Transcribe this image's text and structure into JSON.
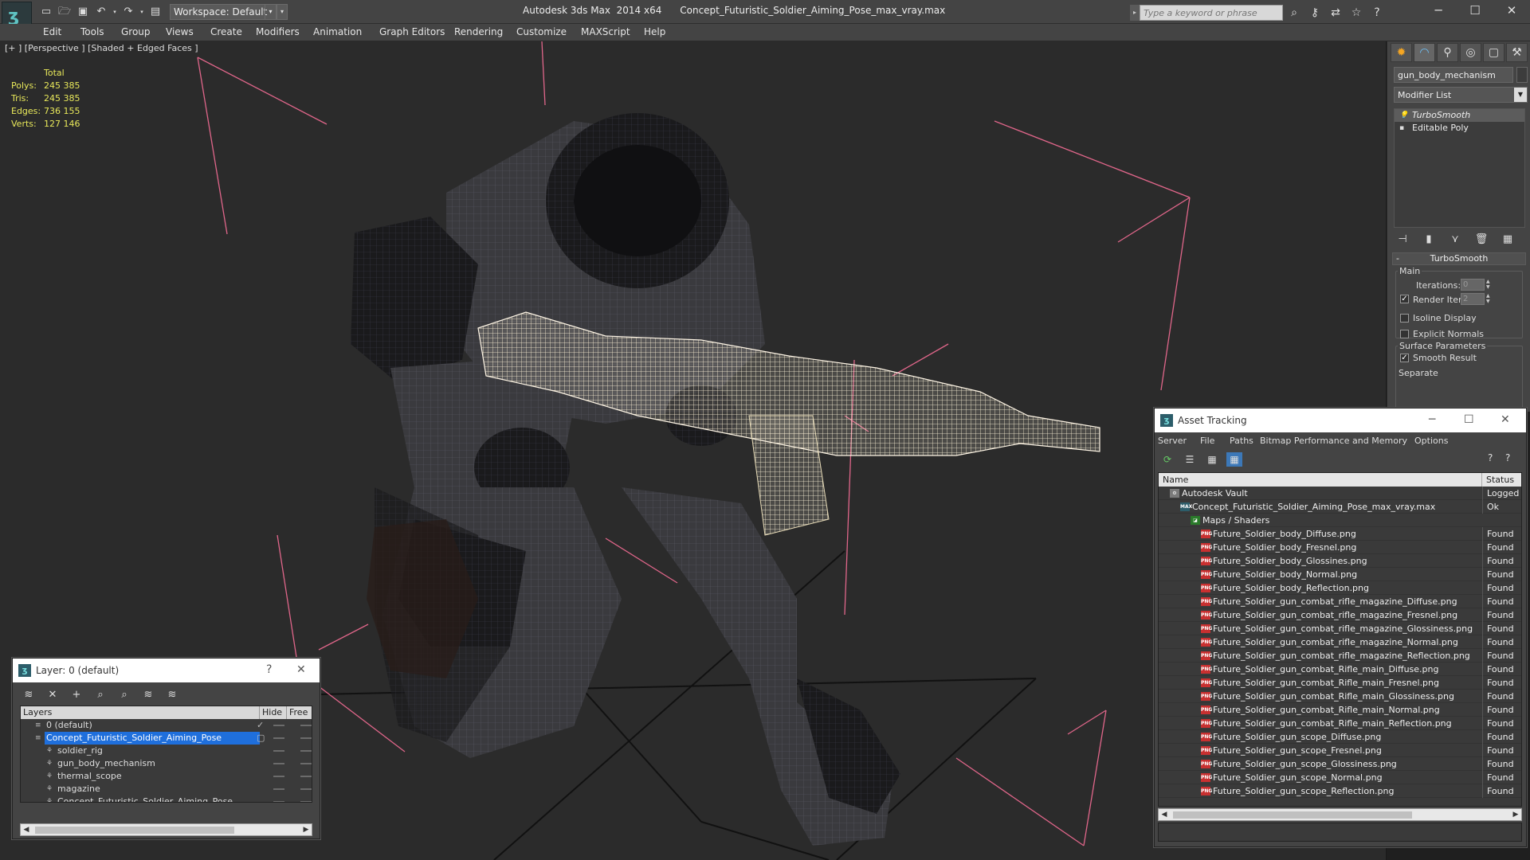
{
  "titlebar": {
    "workspace_label": "Workspace: Default",
    "app_name": "Autodesk 3ds Max  2014 x64",
    "file_name": "Concept_Futuristic_Soldier_Aiming_Pose_max_vray.max",
    "search_placeholder": "Type a keyword or phrase"
  },
  "menubar": [
    "Edit",
    "Tools",
    "Group",
    "Views",
    "Create",
    "Modifiers",
    "Animation",
    "Graph Editors",
    "Rendering",
    "Customize",
    "MAXScript",
    "Help"
  ],
  "viewport": {
    "label": "[+ ] [Perspective ] [Shaded + Edged Faces ]",
    "stats": {
      "header": "Total",
      "rows": [
        {
          "k": "Polys:",
          "v": "245 385"
        },
        {
          "k": "Tris:",
          "v": "245 385"
        },
        {
          "k": "Edges:",
          "v": "736 155"
        },
        {
          "k": "Verts:",
          "v": "127 146"
        }
      ]
    }
  },
  "command_panel": {
    "object_name": "gun_body_mechanism",
    "modifier_list": "Modifier List",
    "stack": [
      "TurboSmooth",
      "Editable Poly"
    ],
    "rollout": "TurboSmooth",
    "group_main": "Main",
    "iterations_label": "Iterations:",
    "iterations_value": "0",
    "render_iters_label": "Render Iters:",
    "render_iters_value": "2",
    "isoline": "Isoline Display",
    "explicit_normals": "Explicit Normals",
    "group_surface": "Surface Parameters",
    "smooth_result": "Smooth Result",
    "separate": "Separate",
    "render_iters_checked": true,
    "smooth_result_checked": true
  },
  "layer_window": {
    "title": "Layer: 0 (default)",
    "help": "?",
    "columns": [
      "Layers",
      "Hide",
      "Free"
    ],
    "rows": [
      {
        "name": "0 (default)",
        "level": 0
      },
      {
        "name": "Concept_Futuristic_Soldier_Aiming_Pose",
        "level": 0,
        "selected": true
      },
      {
        "name": "soldier_rig",
        "level": 1
      },
      {
        "name": "gun_body_mechanism",
        "level": 1
      },
      {
        "name": "thermal_scope",
        "level": 1
      },
      {
        "name": "magazine",
        "level": 1
      },
      {
        "name": "Concept_Futuristic_Soldier_Aiming_Pose",
        "level": 1
      }
    ]
  },
  "asset_window": {
    "title": "Asset Tracking",
    "menu": [
      "Server",
      "File",
      "Paths",
      "Bitmap Performance and Memory",
      "Options"
    ],
    "columns": [
      "Name",
      "Status"
    ],
    "rows": [
      {
        "name": "Autodesk Vault",
        "status": "Logged O",
        "level": 0,
        "icon": "vault"
      },
      {
        "name": "Concept_Futuristic_Soldier_Aiming_Pose_max_vray.max",
        "status": "Ok",
        "level": 1,
        "icon": "max"
      },
      {
        "name": "Maps / Shaders",
        "status": "",
        "level": 2,
        "icon": "maps"
      },
      {
        "name": "Future_Soldier_body_Diffuse.png",
        "status": "Found",
        "level": 3,
        "icon": "png"
      },
      {
        "name": "Future_Soldier_body_Fresnel.png",
        "status": "Found",
        "level": 3,
        "icon": "png"
      },
      {
        "name": "Future_Soldier_body_Glossines.png",
        "status": "Found",
        "level": 3,
        "icon": "png"
      },
      {
        "name": "Future_Soldier_body_Normal.png",
        "status": "Found",
        "level": 3,
        "icon": "png"
      },
      {
        "name": "Future_Soldier_body_Reflection.png",
        "status": "Found",
        "level": 3,
        "icon": "png"
      },
      {
        "name": "Future_Soldier_gun_combat_rifle_magazine_Diffuse.png",
        "status": "Found",
        "level": 3,
        "icon": "png"
      },
      {
        "name": "Future_Soldier_gun_combat_rifle_magazine_Fresnel.png",
        "status": "Found",
        "level": 3,
        "icon": "png"
      },
      {
        "name": "Future_Soldier_gun_combat_rifle_magazine_Glossiness.png",
        "status": "Found",
        "level": 3,
        "icon": "png"
      },
      {
        "name": "Future_Soldier_gun_combat_rifle_magazine_Normal.png",
        "status": "Found",
        "level": 3,
        "icon": "png"
      },
      {
        "name": "Future_Soldier_gun_combat_rifle_magazine_Reflection.png",
        "status": "Found",
        "level": 3,
        "icon": "png"
      },
      {
        "name": "Future_Soldier_gun_combat_Rifle_main_Diffuse.png",
        "status": "Found",
        "level": 3,
        "icon": "png"
      },
      {
        "name": "Future_Soldier_gun_combat_Rifle_main_Fresnel.png",
        "status": "Found",
        "level": 3,
        "icon": "png"
      },
      {
        "name": "Future_Soldier_gun_combat_Rifle_main_Glossiness.png",
        "status": "Found",
        "level": 3,
        "icon": "png"
      },
      {
        "name": "Future_Soldier_gun_combat_Rifle_main_Normal.png",
        "status": "Found",
        "level": 3,
        "icon": "png"
      },
      {
        "name": "Future_Soldier_gun_combat_Rifle_main_Reflection.png",
        "status": "Found",
        "level": 3,
        "icon": "png"
      },
      {
        "name": "Future_Soldier_gun_scope_Diffuse.png",
        "status": "Found",
        "level": 3,
        "icon": "png"
      },
      {
        "name": "Future_Soldier_gun_scope_Fresnel.png",
        "status": "Found",
        "level": 3,
        "icon": "png"
      },
      {
        "name": "Future_Soldier_gun_scope_Glossiness.png",
        "status": "Found",
        "level": 3,
        "icon": "png"
      },
      {
        "name": "Future_Soldier_gun_scope_Normal.png",
        "status": "Found",
        "level": 3,
        "icon": "png"
      },
      {
        "name": "Future_Soldier_gun_scope_Reflection.png",
        "status": "Found",
        "level": 3,
        "icon": "png"
      }
    ]
  },
  "colors": {
    "viewport_bg": "#2b2b2b",
    "stats_text": "#e8e85a",
    "selection_blue": "#1f6fdc",
    "bbox_pink": "#e0668a",
    "png_icon": "#c83030"
  }
}
